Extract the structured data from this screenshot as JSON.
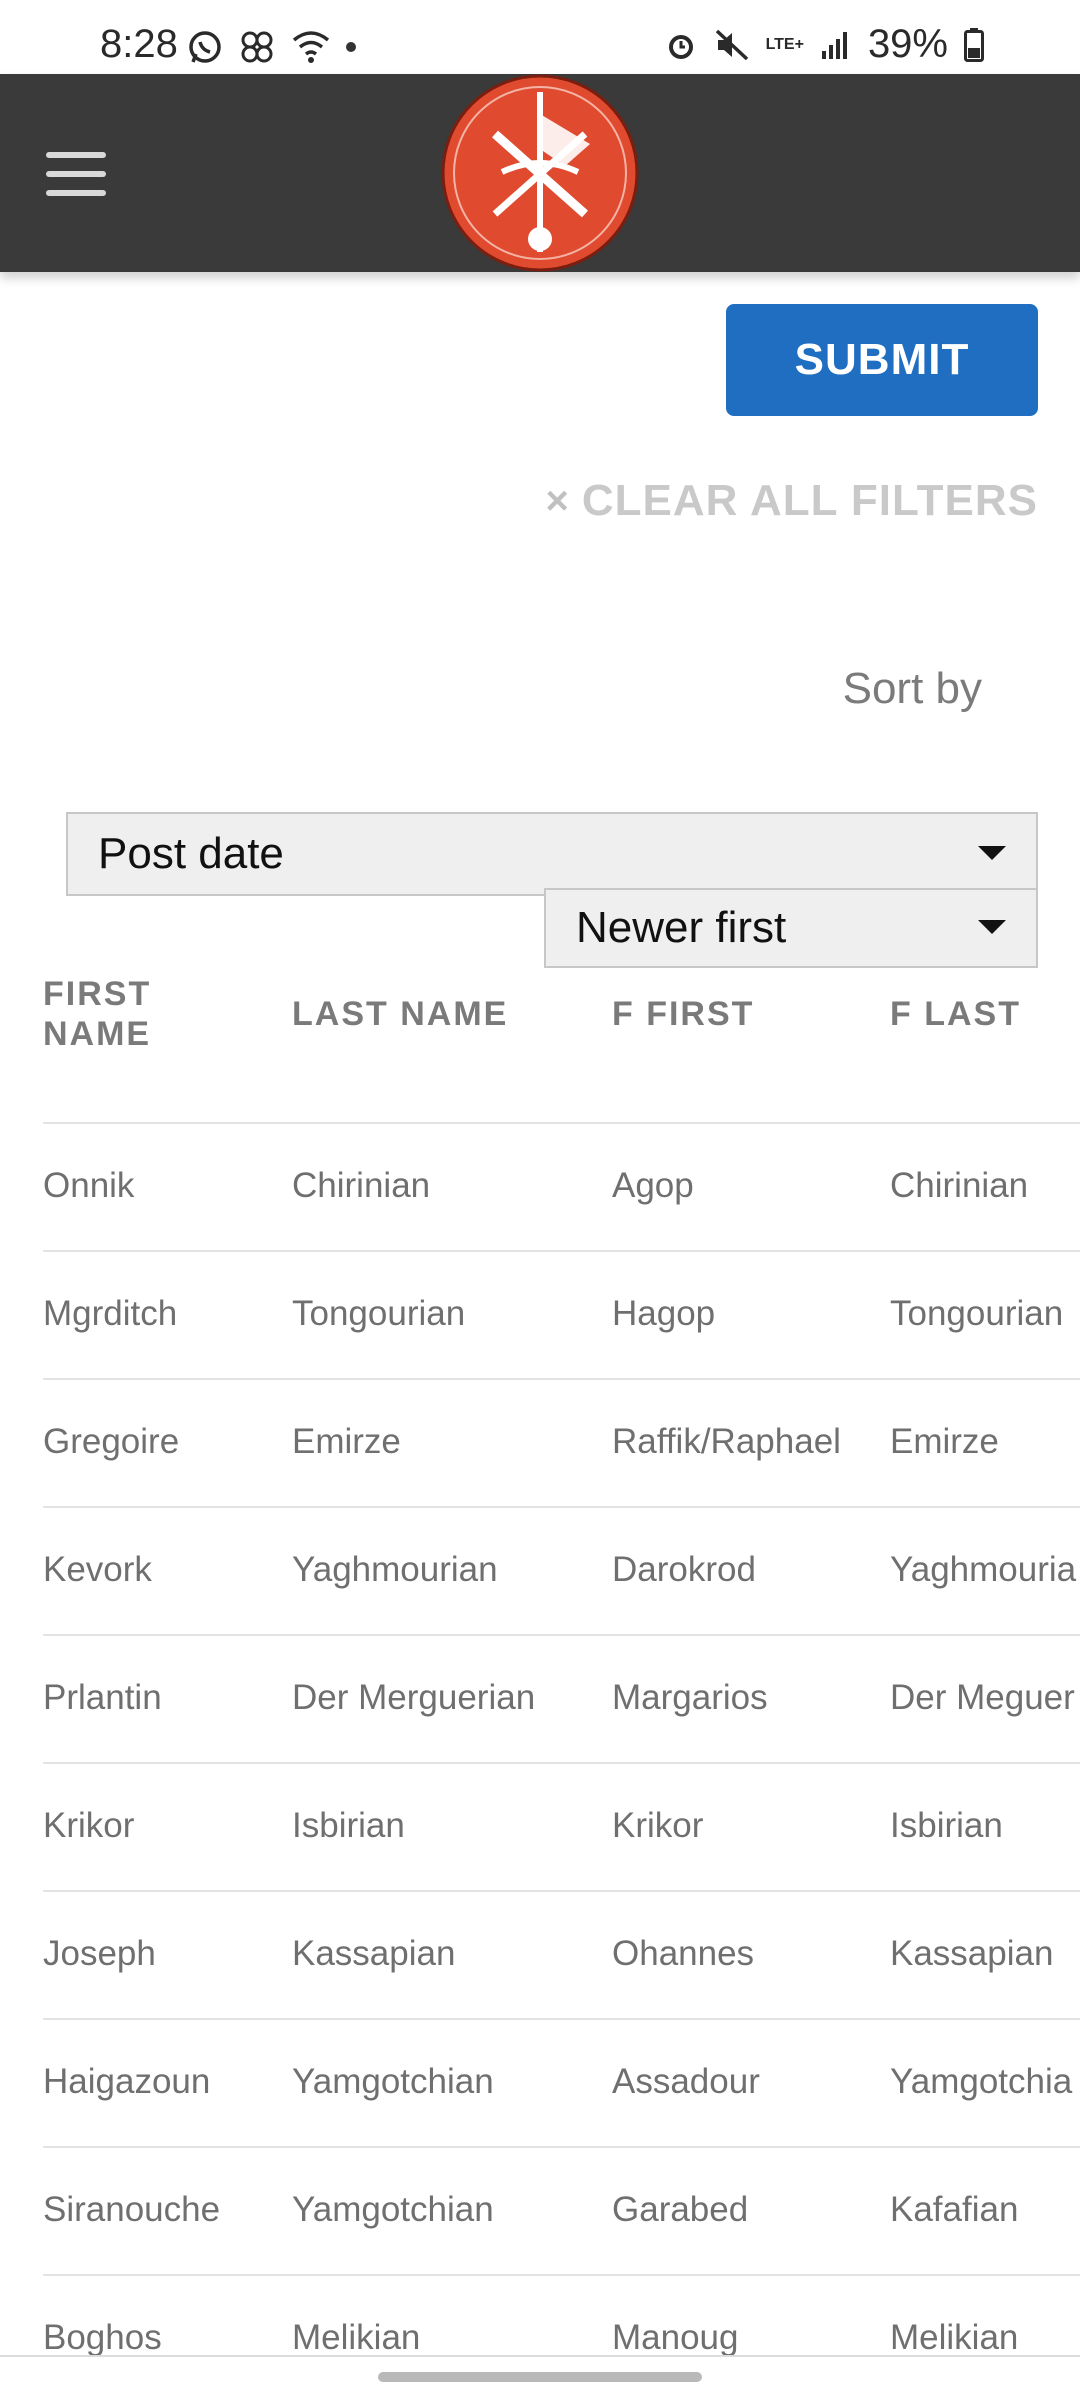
{
  "status_bar": {
    "time": "8:28",
    "battery": "39%",
    "network": "LTE+",
    "left_icons": [
      "whatsapp-icon",
      "pinwheel-icon",
      "wifi-call-icon",
      "dot-icon"
    ],
    "right_icons": [
      "alarm-icon",
      "mute-icon",
      "lte-icon",
      "signal-icon",
      "battery-icon"
    ]
  },
  "header": {
    "menu_icon": "hamburger-icon",
    "logo_icon": "emblem-logo-icon",
    "colors": {
      "bar": "#3a3a3a",
      "logo": "#e04a2f"
    }
  },
  "actions": {
    "submit_label": "SUBMIT",
    "clear_prefix": "×",
    "clear_label": "CLEAR ALL FILTERS"
  },
  "sort": {
    "label": "Sort by",
    "field_value": "Post date",
    "order_value": "Newer first"
  },
  "table": {
    "headers": [
      "FIRST NAME",
      "LAST NAME",
      "F FIRST",
      "F LAST"
    ],
    "rows": [
      [
        "Onnik",
        "Chirinian",
        "Agop",
        "Chirinian"
      ],
      [
        "Mgrditch",
        "Tongourian",
        "Hagop",
        "Tongourian"
      ],
      [
        "Gregoire",
        "Emirze",
        "Raffik/Raphael",
        "Emirze"
      ],
      [
        "Kevork",
        "Yaghmourian",
        "Darokrod",
        "Yaghmouria"
      ],
      [
        "Prlantin",
        "Der Merguerian",
        "Margarios",
        "Der Meguer"
      ],
      [
        "Krikor",
        "Isbirian",
        "Krikor",
        "Isbirian"
      ],
      [
        "Joseph",
        "Kassapian",
        "Ohannes",
        "Kassapian"
      ],
      [
        "Haigazoun",
        "Yamgotchian",
        "Assadour",
        "Yamgotchia"
      ],
      [
        "Siranouche",
        "Yamgotchian",
        "Garabed",
        "Kafafian"
      ],
      [
        "Boghos",
        "Melikian",
        "Manoug",
        "Melikian"
      ]
    ]
  },
  "colors": {
    "submit": "#1f6ec2",
    "clear": "#c9c9c9"
  }
}
